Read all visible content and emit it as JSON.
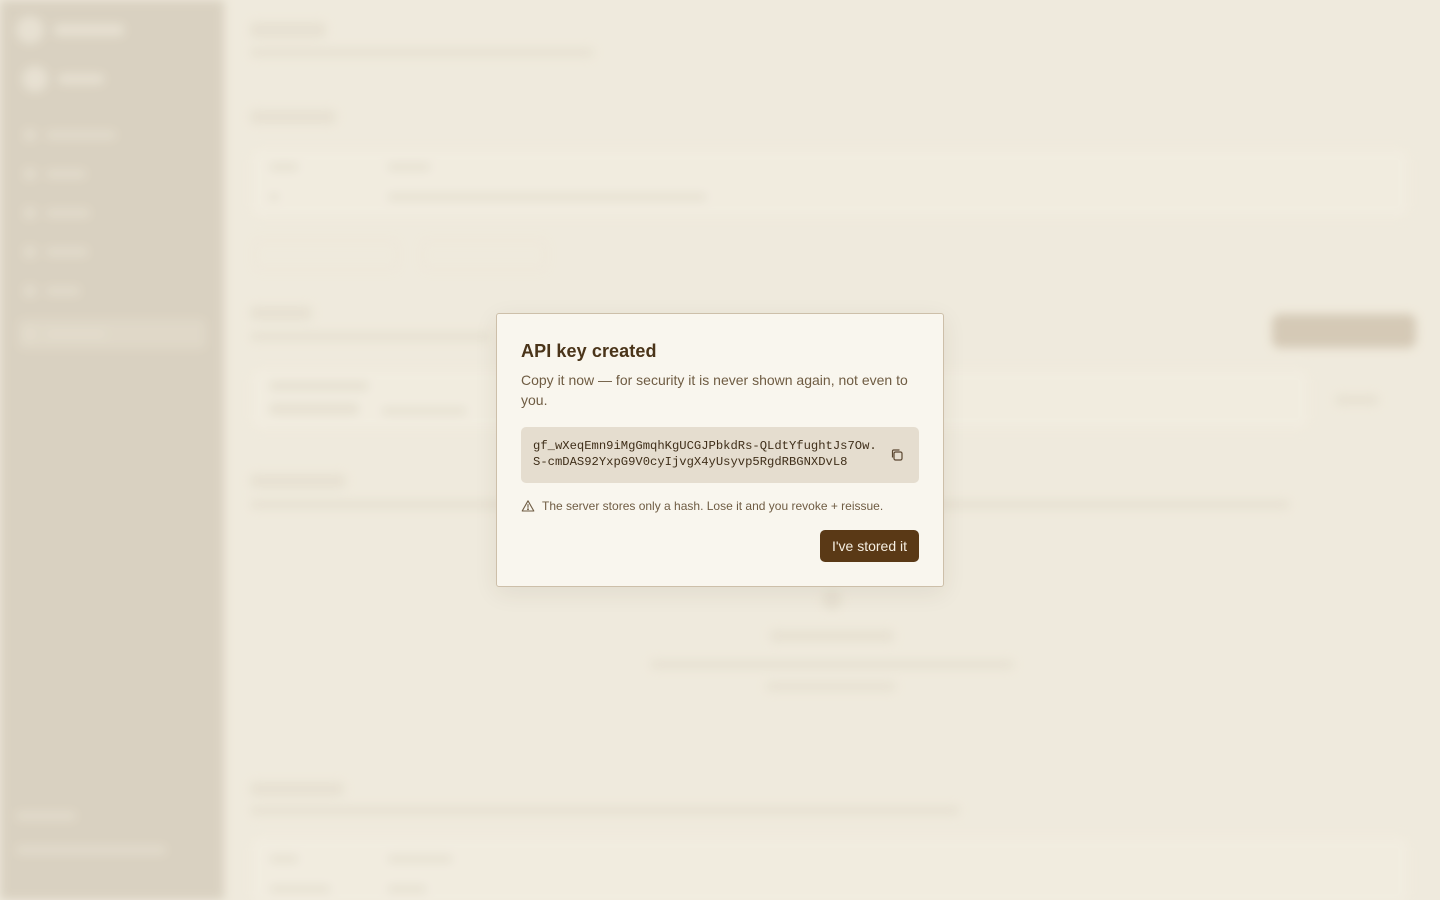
{
  "modal": {
    "title": "API key created",
    "subtitle": "Copy it now — for security it is never shown again, not even to you.",
    "api_key": "gf_wXeqEmn9iMgGmqhKgUCGJPbkdRs-QLdtYfughtJs7Ow.S-cmDAS92YxpG9V0cyIjvgX4yUsyvp5RgdRBGNXDvL8",
    "copy_icon": "copy-icon",
    "warning_icon": "warning-triangle-icon",
    "warning_text": "The server stores only a hash. Lose it and you revoke + reissue.",
    "confirm_label": "I've stored it"
  },
  "colors": {
    "accent": "#5a3916",
    "background": "#efeadd",
    "sidebar": "#b2a590",
    "modal_bg": "#f9f6ee",
    "key_bg": "#e5ddcf"
  }
}
